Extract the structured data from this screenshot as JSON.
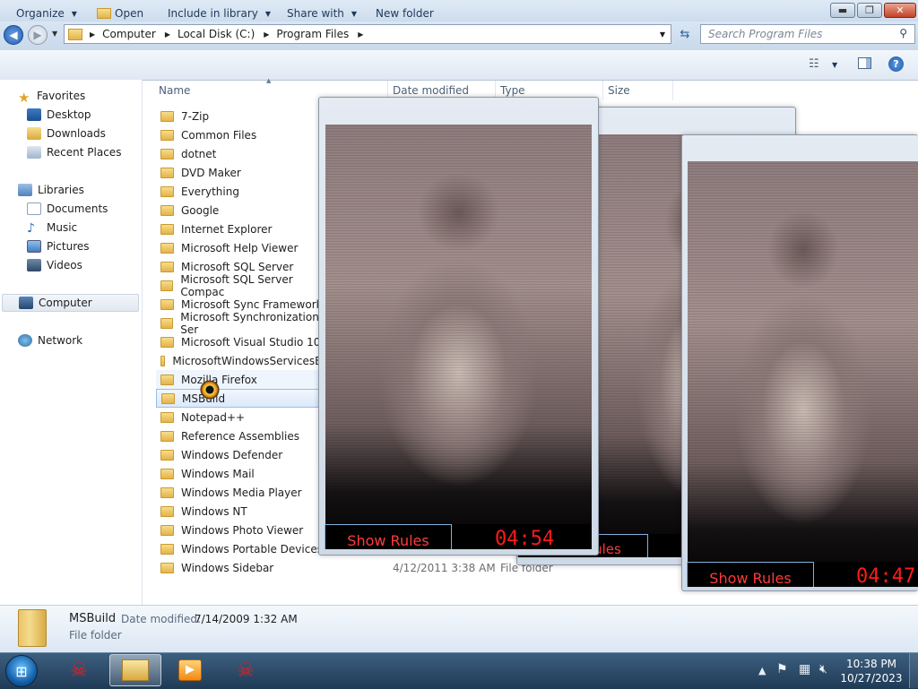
{
  "window": {
    "caption_buttons": {
      "minimize": "▬",
      "maximize": "❐",
      "close": "✕"
    }
  },
  "address": {
    "crumbs": [
      "Computer",
      "Local Disk (C:)",
      "Program Files"
    ],
    "search_placeholder": "Search Program Files"
  },
  "toolbar": {
    "organize": "Organize",
    "open": "Open",
    "include_in_library": "Include in library",
    "share_with": "Share with",
    "new_folder": "New folder"
  },
  "nav": {
    "favorites": "Favorites",
    "desktop": "Desktop",
    "downloads": "Downloads",
    "recent_places": "Recent Places",
    "libraries": "Libraries",
    "documents": "Documents",
    "music": "Music",
    "pictures": "Pictures",
    "videos": "Videos",
    "computer": "Computer",
    "network": "Network"
  },
  "columns": {
    "name": "Name",
    "date_modified": "Date modified",
    "type": "Type",
    "size": "Size"
  },
  "files": [
    "7-Zip",
    "Common Files",
    "dotnet",
    "DVD Maker",
    "Everything",
    "Google",
    "Internet Explorer",
    "Microsoft Help Viewer",
    "Microsoft SQL Server",
    "Microsoft SQL Server Compac",
    "Microsoft Sync Framework",
    "Microsoft Synchronization Ser",
    "Microsoft Visual Studio 10.0",
    "MicrosoftWindowsServicesEtc",
    "Mozilla Firefox",
    "MSBuild",
    "Notepad++",
    "Reference Assemblies",
    "Windows Defender",
    "Windows Mail",
    "Windows Media Player",
    "Windows NT",
    "Windows Photo Viewer",
    "Windows Portable Devices",
    "Windows Sidebar"
  ],
  "last_row": {
    "date": "4/12/2011 3:38 AM",
    "type": "File folder"
  },
  "details": {
    "name": "MSBuild",
    "date_label": "Date modified:",
    "date_value": "7/14/2009 1:32 AM",
    "type": "File folder"
  },
  "popups": [
    {
      "button": "Show Rules",
      "timer": "04:54"
    },
    {
      "button": "Show Rules",
      "timer": ""
    },
    {
      "button": "Show Rules",
      "timer": "04:47"
    }
  ],
  "taskbar": {
    "clock_time": "10:38 PM",
    "clock_date": "10/27/2023",
    "tray_icons": [
      "show-hidden-icons",
      "action-center-icon",
      "network-icon",
      "volume-muted-icon"
    ]
  },
  "colors": {
    "accent": "#1e395b",
    "timer_red": "#ff1a1a",
    "selection": "#cce4f7"
  }
}
